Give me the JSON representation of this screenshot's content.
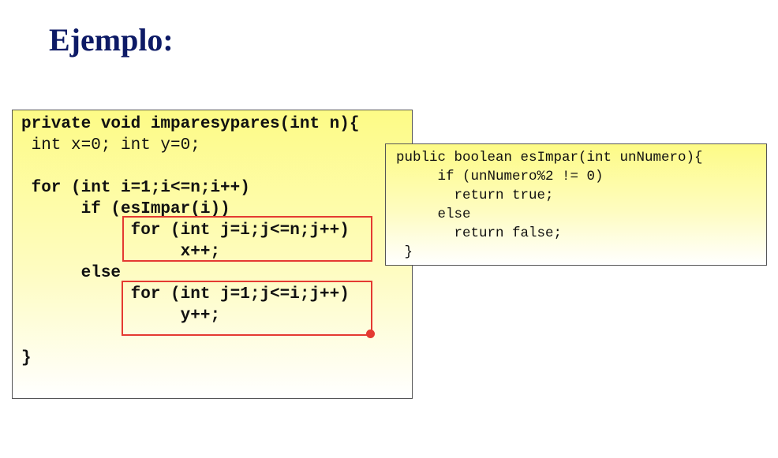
{
  "title": "Ejemplo:",
  "main_code": {
    "lines": [
      "private void imparesypares(int n){",
      " int x=0; int y=0;",
      " for (int i=1;i<=n;i++)",
      "      if (esImpar(i))",
      "           for (int j=i;j<=n;j++)",
      "                x++;",
      "      else",
      "           for (int j=1;j<=i;j++)",
      "                y++;",
      "}"
    ]
  },
  "helper_code": {
    "lines": [
      "public boolean esImpar(int unNumero){",
      "     if (unNumero%2 != 0)",
      "       return true;",
      "     else",
      "       return false;",
      " }"
    ]
  },
  "colors": {
    "title": "#0d1a66",
    "highlight": "#e43a32",
    "box_fill_top": "#fdfb86"
  }
}
